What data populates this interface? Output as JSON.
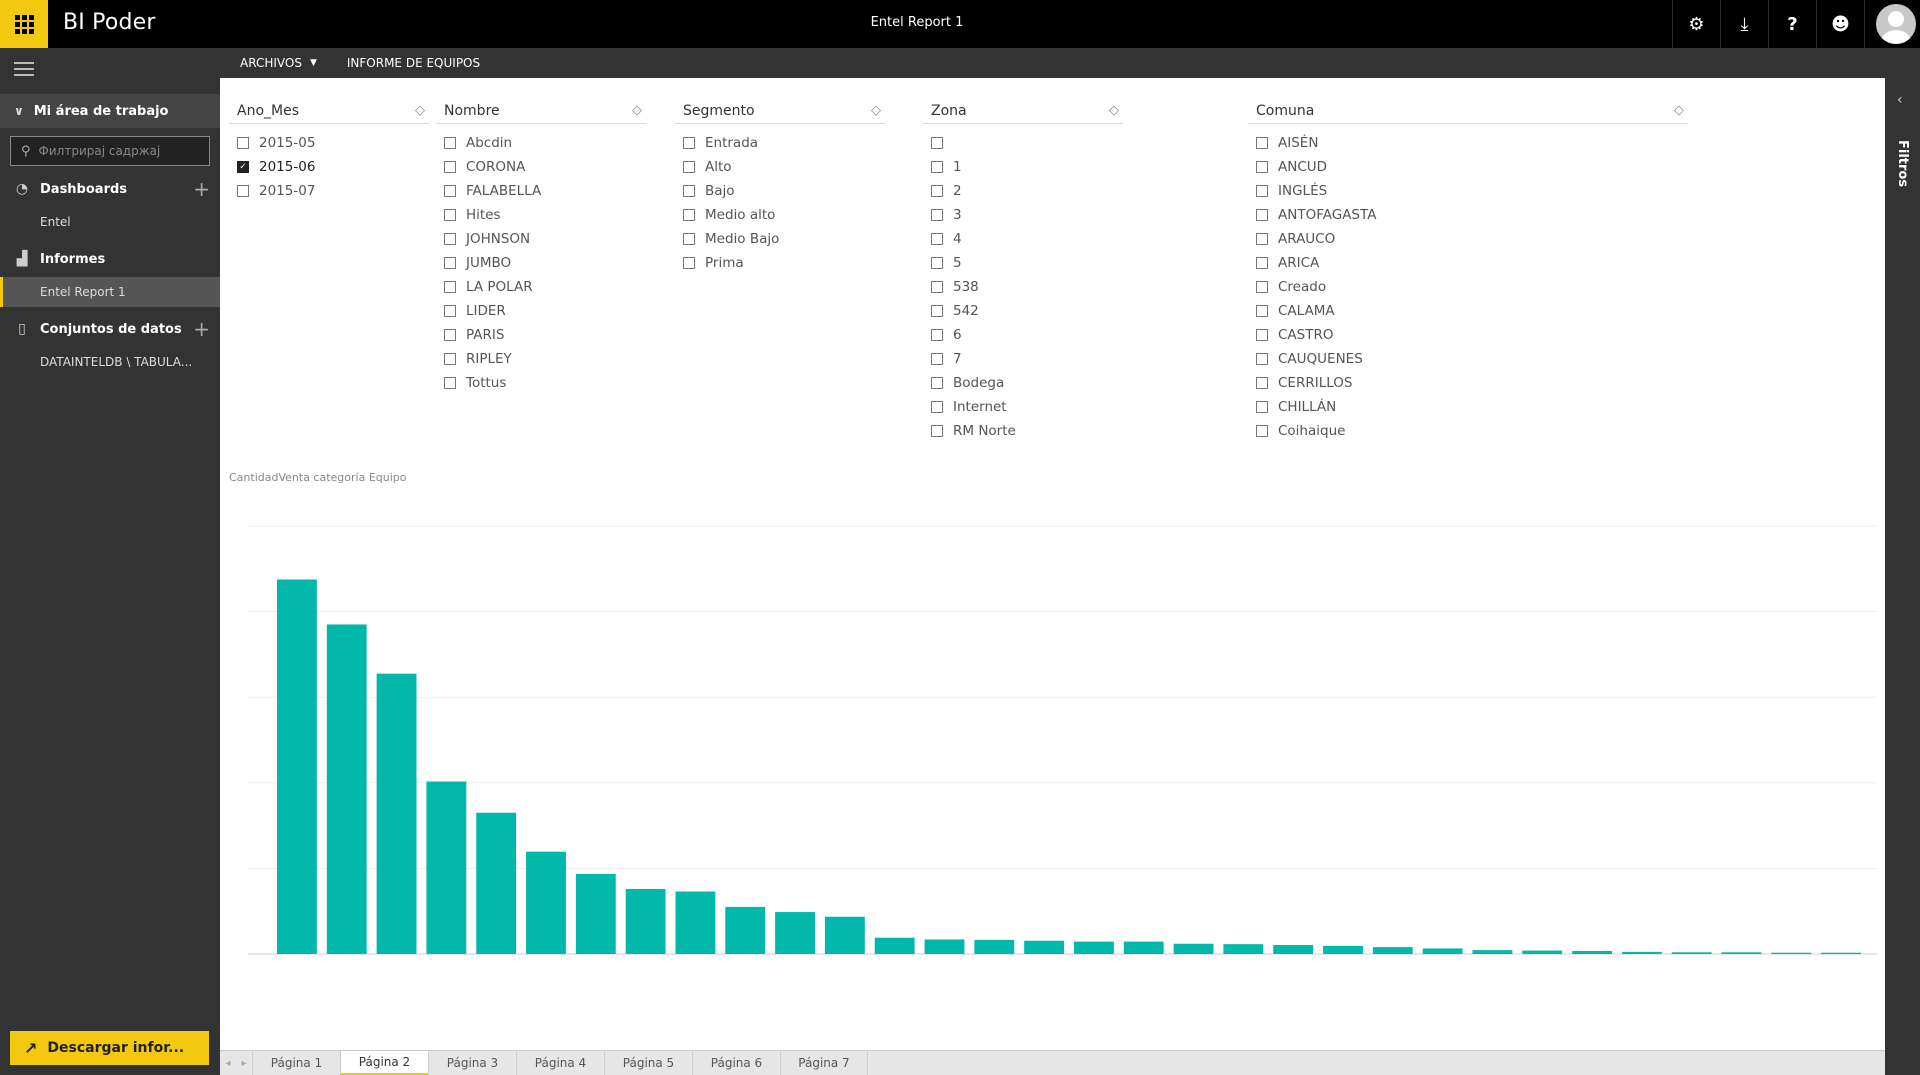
{
  "app": {
    "brand": "BI Poder",
    "report_title": "Entel Report 1",
    "accent": "#f2c811"
  },
  "topbar_icons": [
    "gear-icon",
    "download-icon",
    "help-icon",
    "smiley-icon",
    "avatar"
  ],
  "sidebar": {
    "workspace_label": "Mi área de trabajo",
    "search_placeholder": "Филтрирај садржај",
    "sections": {
      "dashboards": {
        "label": "Dashboards",
        "items": [
          "Entel"
        ]
      },
      "reports": {
        "label": "Informes",
        "items": [
          "Entel Report 1"
        ]
      },
      "datasets": {
        "label": "Conjuntos de datos",
        "items": [
          "DATAINTELDB \\ TABULA..."
        ]
      }
    },
    "download_label": "Descargar infor..."
  },
  "menubar": {
    "file_label": "ARCHIVOS",
    "report_name": "INFORME DE EQUIPOS"
  },
  "filters_pane": {
    "label": "Filtros"
  },
  "slicers": [
    {
      "title": "Ano_Mes",
      "options": [
        {
          "label": "2015-05",
          "checked": false
        },
        {
          "label": "2015-06",
          "checked": true
        },
        {
          "label": "2015-07",
          "checked": false
        }
      ]
    },
    {
      "title": "Nombre",
      "options": [
        {
          "label": "Abcdin",
          "checked": false
        },
        {
          "label": "CORONA",
          "checked": false
        },
        {
          "label": "FALABELLA",
          "checked": false
        },
        {
          "label": "Hites",
          "checked": false
        },
        {
          "label": "JOHNSON",
          "checked": false
        },
        {
          "label": "JUMBO",
          "checked": false
        },
        {
          "label": "LA POLAR",
          "checked": false
        },
        {
          "label": "LIDER",
          "checked": false
        },
        {
          "label": "PARIS",
          "checked": false
        },
        {
          "label": "RIPLEY",
          "checked": false
        },
        {
          "label": "Tottus",
          "checked": false
        }
      ]
    },
    {
      "title": "Segmento",
      "options": [
        {
          "label": "Entrada",
          "checked": false
        },
        {
          "label": "Alto",
          "checked": false
        },
        {
          "label": "Bajo",
          "checked": false
        },
        {
          "label": "Medio alto",
          "checked": false
        },
        {
          "label": "Medio Bajo",
          "checked": false
        },
        {
          "label": "Prima",
          "checked": false
        }
      ]
    },
    {
      "title": "Zona",
      "options": [
        {
          "label": "",
          "checked": false
        },
        {
          "label": "1",
          "checked": false
        },
        {
          "label": "2",
          "checked": false
        },
        {
          "label": "3",
          "checked": false
        },
        {
          "label": "4",
          "checked": false
        },
        {
          "label": "5",
          "checked": false
        },
        {
          "label": "538",
          "checked": false
        },
        {
          "label": "542",
          "checked": false
        },
        {
          "label": "6",
          "checked": false
        },
        {
          "label": "7",
          "checked": false
        },
        {
          "label": "Bodega",
          "checked": false
        },
        {
          "label": "Internet",
          "checked": false
        },
        {
          "label": "RM Norte",
          "checked": false
        }
      ]
    },
    {
      "title": "Comuna",
      "options": [
        {
          "label": "AISÉN",
          "checked": false
        },
        {
          "label": "ANCUD",
          "checked": false
        },
        {
          "label": "INGLÉS",
          "checked": false
        },
        {
          "label": "ANTOFAGASTA",
          "checked": false
        },
        {
          "label": "ARAUCO",
          "checked": false
        },
        {
          "label": "ARICA",
          "checked": false
        },
        {
          "label": "Creado",
          "checked": false
        },
        {
          "label": "CALAMA",
          "checked": false
        },
        {
          "label": "CASTRO",
          "checked": false
        },
        {
          "label": "CAUQUENES",
          "checked": false
        },
        {
          "label": "CERRILLOS",
          "checked": false
        },
        {
          "label": "CHILLÁN",
          "checked": false
        },
        {
          "label": "Coihaique",
          "checked": false
        }
      ]
    }
  ],
  "chart_data": {
    "type": "bar",
    "title": "CantidadVenta categoría Equipo",
    "bar_color": "#01b8aa",
    "grid": true,
    "ylim": [
      0,
      100
    ],
    "values": [
      87.5,
      77.0,
      65.5,
      40.3,
      33.0,
      23.9,
      18.7,
      15.2,
      14.6,
      11.0,
      9.8,
      8.7,
      3.8,
      3.4,
      3.3,
      3.1,
      2.9,
      2.9,
      2.4,
      2.3,
      2.1,
      1.9,
      1.6,
      1.3,
      0.9,
      0.8,
      0.7,
      0.5,
      0.4,
      0.4,
      0.3,
      0.3
    ]
  },
  "tabs": {
    "items": [
      "Página 1",
      "Página 2",
      "Página 3",
      "Página 4",
      "Página 5",
      "Página 6",
      "Página 7"
    ],
    "active_index": 1
  }
}
